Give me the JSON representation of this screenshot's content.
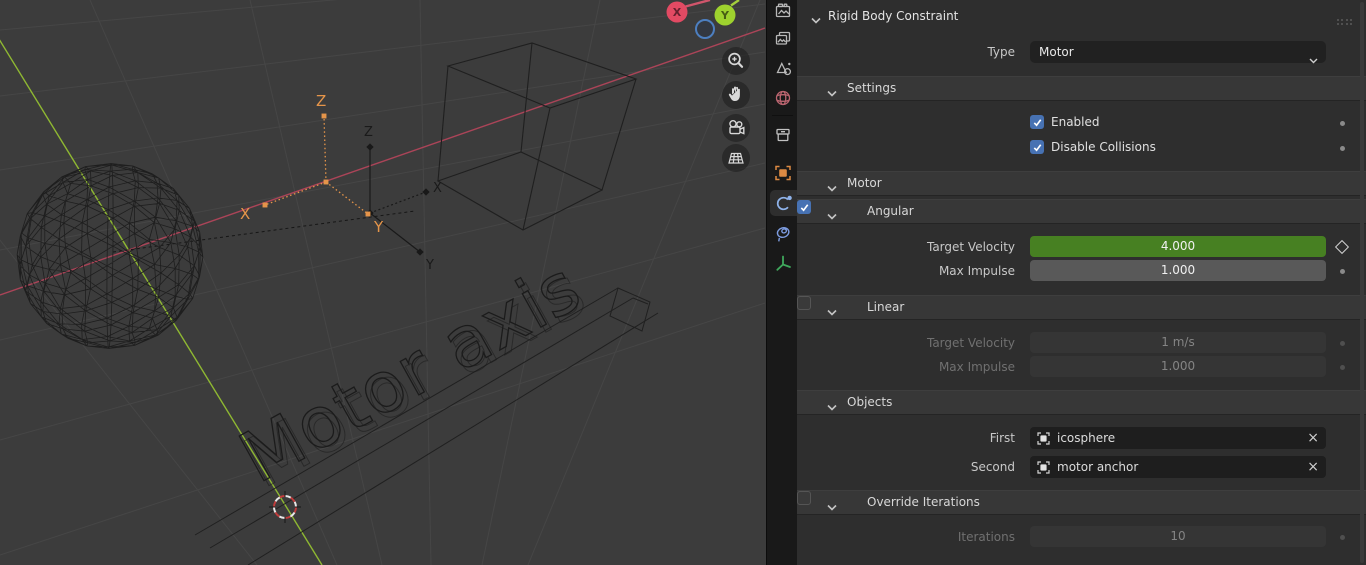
{
  "app_title": "Blender - Rigid Body Constraint properties",
  "viewport": {
    "scene_text": "Motor axis",
    "orange_empty": {
      "x": "X",
      "y": "Y",
      "z": "Z"
    },
    "dark_empty": {
      "x": "X",
      "y": "Y",
      "z": "Z"
    },
    "gizmo": {
      "x": "X",
      "y": "Y"
    },
    "nav_buttons": [
      "zoom",
      "move-view",
      "camera-view",
      "toggle-grid-view"
    ]
  },
  "tabbar": {
    "tabs": [
      "render-properties",
      "view-layer-properties",
      "scene-properties",
      "world-properties",
      "collection-properties",
      "object-properties",
      "physics-properties",
      "constraint-properties",
      "object-data-properties"
    ],
    "selected": "physics-properties"
  },
  "panel": {
    "title": "Rigid Body Constraint",
    "type_label": "Type",
    "type_value": "Motor",
    "settings_title": "Settings",
    "enabled_label": "Enabled",
    "disable_collisions_label": "Disable Collisions",
    "motor_title": "Motor",
    "angular_title": "Angular",
    "angular_tv_label": "Target Velocity",
    "angular_tv_value": "4.000",
    "angular_mi_label": "Max Impulse",
    "angular_mi_value": "1.000",
    "linear_title": "Linear",
    "linear_tv_label": "Target Velocity",
    "linear_tv_value": "1 m/s",
    "linear_mi_label": "Max Impulse",
    "linear_mi_value": "1.000",
    "objects_title": "Objects",
    "first_label": "First",
    "first_value": "icosphere",
    "second_label": "Second",
    "second_value": "motor anchor",
    "override_title": "Override Iterations",
    "iterations_label": "Iterations",
    "iterations_value": "10",
    "clear_x": "×"
  },
  "colors": {
    "keyframed_green": "#478022",
    "checkbox_blue": "#4772b3",
    "selected_object_orange": "#e5954a",
    "axis_x_red": "#ab4458",
    "axis_y_green": "#8fb832"
  }
}
